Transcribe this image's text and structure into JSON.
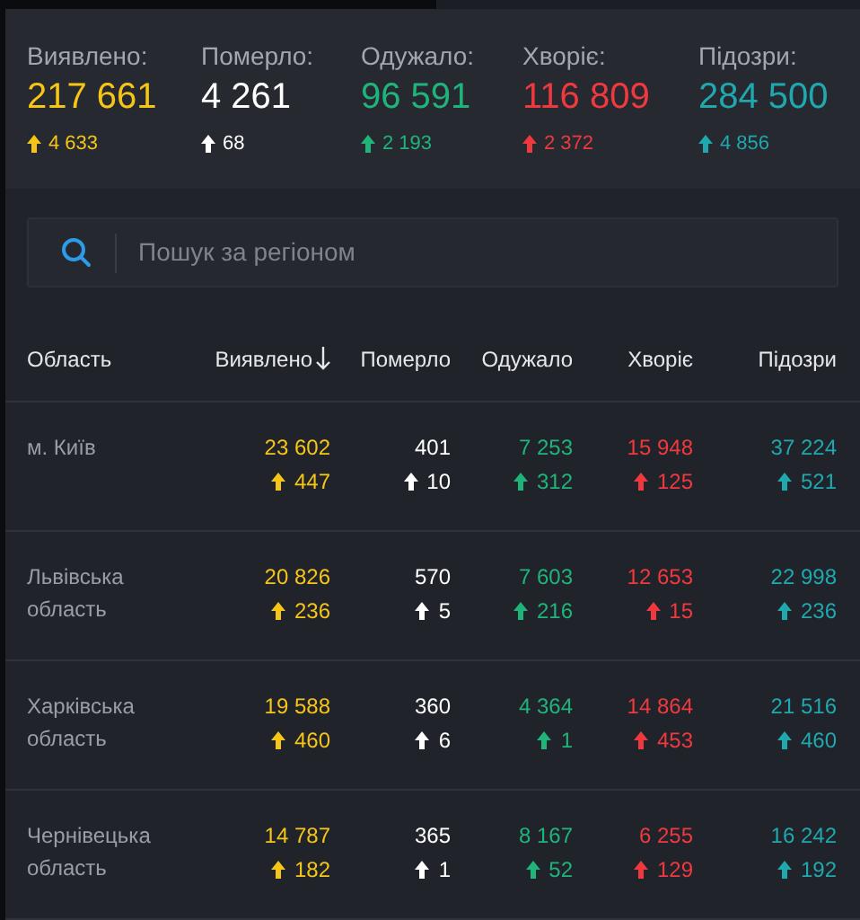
{
  "stats": [
    {
      "label": "Виявлено:",
      "value": "217 661",
      "delta": "4 633",
      "color": "#f5c518"
    },
    {
      "label": "Померло:",
      "value": "4 261",
      "delta": "68",
      "color": "#ffffff"
    },
    {
      "label": "Одужало:",
      "value": "96 591",
      "delta": "2 193",
      "color": "#1fb47a"
    },
    {
      "label": "Хворіє:",
      "value": "116 809",
      "delta": "2 372",
      "color": "#f0393f"
    },
    {
      "label": "Підозри:",
      "value": "284 500",
      "delta": "4 856",
      "color": "#1fa8ae"
    }
  ],
  "search": {
    "placeholder": "Пошук за регіоном"
  },
  "table": {
    "columns": [
      {
        "label": "Область",
        "sorted": false
      },
      {
        "label": "Виявлено",
        "sorted": true,
        "color": "#f5c518"
      },
      {
        "label": "Померло",
        "sorted": false,
        "color": "#ffffff"
      },
      {
        "label": "Одужало",
        "sorted": false,
        "color": "#1fb47a"
      },
      {
        "label": "Хворіє",
        "sorted": false,
        "color": "#f0393f"
      },
      {
        "label": "Підозри",
        "sorted": false,
        "color": "#1fa8ae"
      }
    ],
    "rows": [
      {
        "cells": [
          {
            "value": "м. Київ"
          },
          {
            "value": "23 602",
            "delta": "447"
          },
          {
            "value": "401",
            "delta": "10"
          },
          {
            "value": "7 253",
            "delta": "312"
          },
          {
            "value": "15 948",
            "delta": "125"
          },
          {
            "value": "37 224",
            "delta": "521"
          }
        ]
      },
      {
        "cells": [
          {
            "value": "Львівська область"
          },
          {
            "value": "20 826",
            "delta": "236"
          },
          {
            "value": "570",
            "delta": "5"
          },
          {
            "value": "7 603",
            "delta": "216"
          },
          {
            "value": "12 653",
            "delta": "15"
          },
          {
            "value": "22 998",
            "delta": "236"
          }
        ]
      },
      {
        "cells": [
          {
            "value": "Харківська область"
          },
          {
            "value": "19 588",
            "delta": "460"
          },
          {
            "value": "360",
            "delta": "6"
          },
          {
            "value": "4 364",
            "delta": "1"
          },
          {
            "value": "14 864",
            "delta": "453"
          },
          {
            "value": "21 516",
            "delta": "460"
          }
        ]
      },
      {
        "cells": [
          {
            "value": "Чернівецька область"
          },
          {
            "value": "14 787",
            "delta": "182"
          },
          {
            "value": "365",
            "delta": "1"
          },
          {
            "value": "8 167",
            "delta": "52"
          },
          {
            "value": "6 255",
            "delta": "129"
          },
          {
            "value": "16 242",
            "delta": "192"
          }
        ]
      }
    ]
  }
}
